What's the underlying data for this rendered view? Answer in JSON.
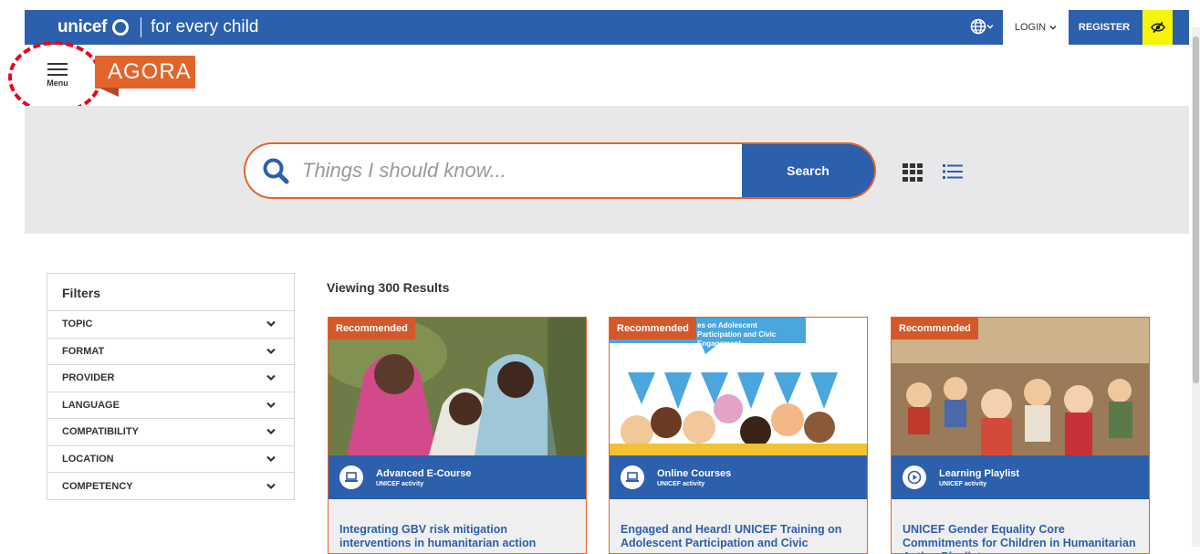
{
  "topbar": {
    "brand_name": "unicef",
    "brand_tagline": "for every child",
    "login_label": "LOGIN",
    "register_label": "REGISTER"
  },
  "header": {
    "menu_label": "Menu",
    "logo_text": "AGORA"
  },
  "search": {
    "placeholder": "Things I should know...",
    "button_label": "Search"
  },
  "filters": {
    "title": "Filters",
    "items": [
      {
        "label": "TOPIC"
      },
      {
        "label": "FORMAT"
      },
      {
        "label": "PROVIDER"
      },
      {
        "label": "LANGUAGE"
      },
      {
        "label": "COMPATIBILITY"
      },
      {
        "label": "LOCATION"
      },
      {
        "label": "COMPETENCY"
      }
    ]
  },
  "results": {
    "title": "Viewing 300 Results",
    "cards": [
      {
        "badge": "Recommended",
        "format": "Advanced E-Course",
        "provider": "UNICEF activity",
        "icon": "laptop-icon",
        "title": "Integrating GBV risk mitigation interventions in humanitarian action"
      },
      {
        "badge": "Recommended",
        "format": "Online Courses",
        "provider": "UNICEF activity",
        "icon": "laptop-icon",
        "image_text": "es on Adolescent Participation and Civic Engagement",
        "title": "Engaged and Heard! UNICEF Training on Adolescent Participation and Civic"
      },
      {
        "badge": "Recommended",
        "format": "Learning Playlist",
        "provider": "UNICEF activity",
        "icon": "play-icon",
        "title": "UNICEF Gender Equality Core Commitments for Children in Humanitarian Action Playlist"
      }
    ]
  },
  "colors": {
    "brand_blue": "#2c5fac",
    "accent_orange": "#e2642b",
    "highlight_yellow": "#f5f50a",
    "annotation_red": "#e8061a"
  }
}
